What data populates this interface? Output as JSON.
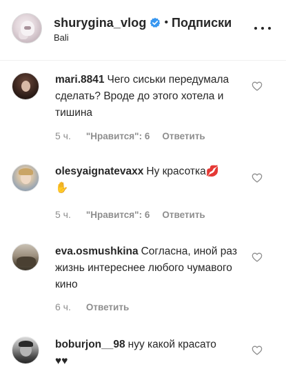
{
  "post_header": {
    "username": "shurygina_vlog",
    "separator": "•",
    "follow_label": "Подписки",
    "location": "Bali",
    "verified": true,
    "more_icon": "more-dots-icon"
  },
  "comments": [
    {
      "username": "mari.8841",
      "text": "Чего сиськи передумала сделать? Вроде до этого хотела и тишина",
      "time": "5 ч.",
      "likes": "\"Нравится\": 6",
      "reply_label": "Ответить"
    },
    {
      "username": "olesyaignatevaxx",
      "text": "Ну красотка",
      "emoji": [
        "💋",
        "✋"
      ],
      "time": "5 ч.",
      "likes": "\"Нравится\": 6",
      "reply_label": "Ответить"
    },
    {
      "username": "eva.osmushkina",
      "text": "Согласна, иной раз жизнь интереснее любого чумавого кино",
      "time": "6 ч.",
      "reply_label": "Ответить"
    },
    {
      "username": "boburjon__98",
      "text": "нуу какой красато",
      "emoji": [
        "♥♥"
      ]
    }
  ],
  "colors": {
    "verified_badge": "#3897f0",
    "text_primary": "#262626",
    "text_secondary": "#8e8e8e",
    "divider": "#efefef"
  }
}
